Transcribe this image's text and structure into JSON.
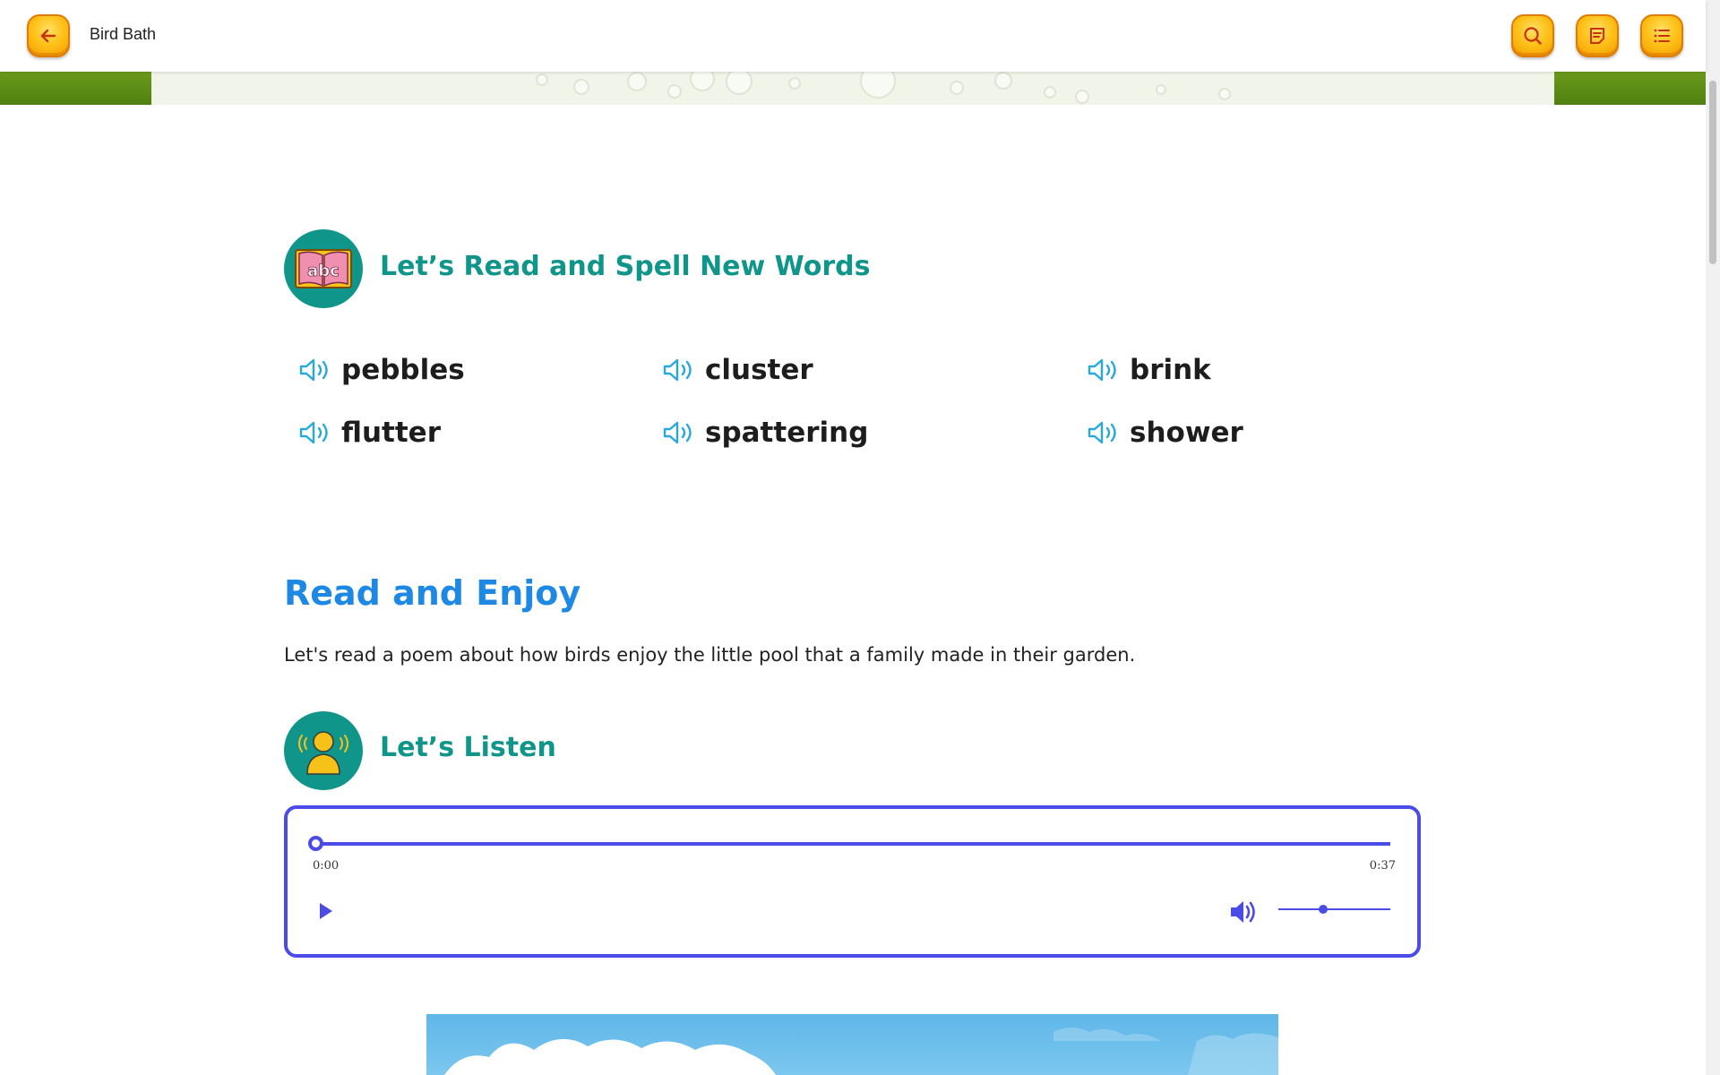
{
  "app": {
    "title": "Bird Bath"
  },
  "toolbar": {
    "back_icon": "arrow-left-icon",
    "search_icon": "search-icon",
    "notes_icon": "notes-icon",
    "menu_icon": "list-menu-icon"
  },
  "vocab": {
    "heading": "Let’s Read and Spell New Words",
    "icon": "abc-book-icon",
    "words": [
      "pebbles",
      "cluster",
      "brink",
      "flutter",
      "spattering",
      "shower"
    ],
    "speaker_icon": "speaker-icon"
  },
  "read": {
    "heading": "Read and Enjoy",
    "intro": "Let's read a poem about how birds enjoy the little pool that a family made in their garden."
  },
  "listen": {
    "heading": "Let’s Listen",
    "icon": "listener-icon"
  },
  "player": {
    "current_time": "0:00",
    "duration": "0:37",
    "progress": 0,
    "volume": 0.4,
    "accent": "#4b4be8"
  },
  "colors": {
    "teal": "#10958a",
    "blue_heading": "#1e88e5",
    "button_orange": "#ffc21a",
    "speaker_blue": "#29a8e0"
  }
}
